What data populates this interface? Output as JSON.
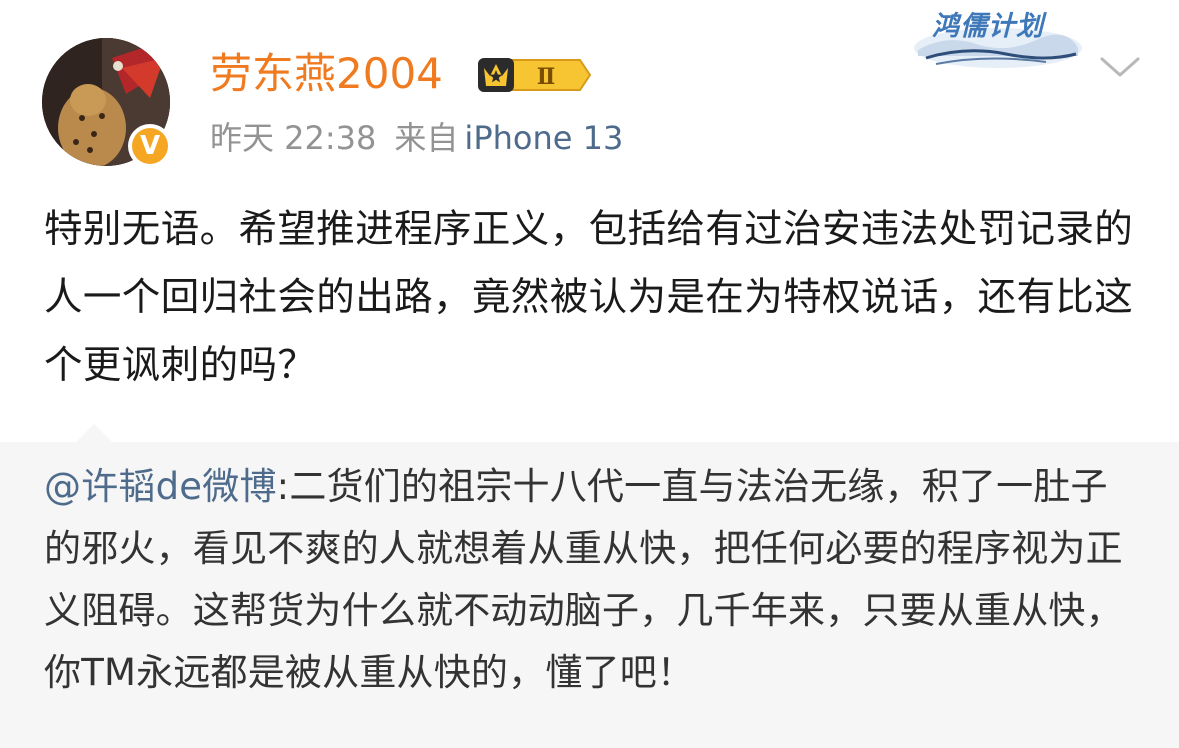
{
  "post": {
    "username": "劳东燕2004",
    "verified_badge": "V",
    "level_badge": "Ⅱ",
    "meta": {
      "time": "昨天 22:38",
      "source_prefix": "来自",
      "device": "iPhone 13"
    },
    "text": "特别无语。希望推进程序正义，包括给有过治安违法处罚记录的人一个回归社会的出路，竟然被认为是在为特权说话，还有比这个更讽刺的吗？"
  },
  "header_logo": {
    "text": "鸿儒计划",
    "icon": "ink-landscape-logo"
  },
  "menu_icon": "chevron-down-icon",
  "repost": {
    "author": "@许韬de微博",
    "separator": ":",
    "text": "二货们的祖宗十八代一直与法治无缘，积了一肚子的邪火，看见不爽的人就想着从重从快，把任何必要的程序视为正义阻碍。这帮货为什么就不动动脑子，几千年来，只要从重从快，你TM永远都是被从重从快的，懂了吧！"
  },
  "colors": {
    "username": "#f07a1f",
    "meta": "#939393",
    "link": "#4e6b8c",
    "body_text": "#1a1a1a",
    "repost_bg": "#f6f6f6",
    "verified": "#f5a623"
  }
}
